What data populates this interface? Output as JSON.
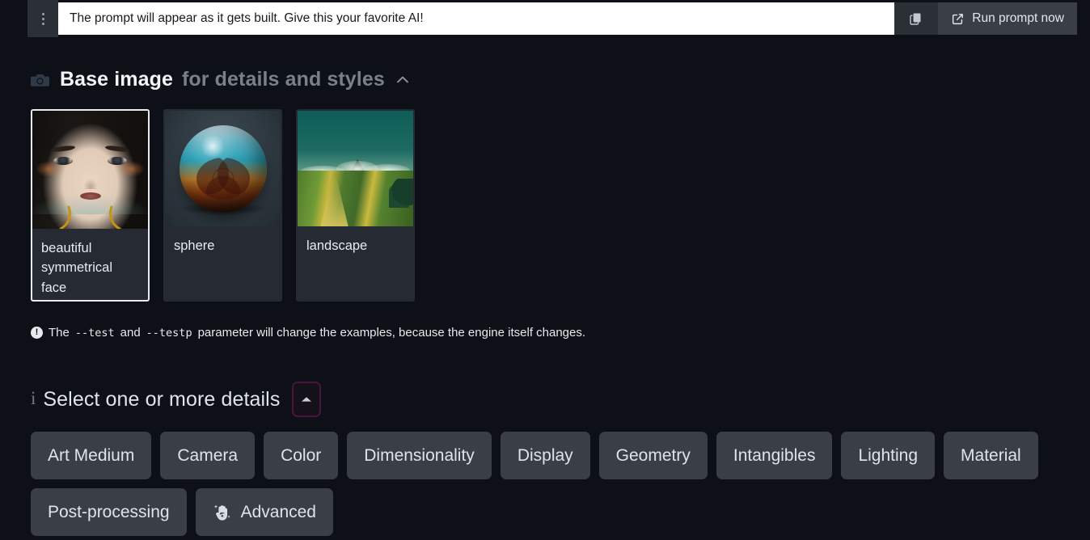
{
  "topbar": {
    "menu_icon": "kebab-menu-icon",
    "prompt_value": "The prompt will appear as it gets built. Give this your favorite AI!",
    "prompt_placeholder": "The prompt will appear as it gets built. Give this your favorite AI!",
    "copy_icon": "copy-icon",
    "run_icon": "external-link-icon",
    "run_label": "Run prompt now"
  },
  "base_image": {
    "icon": "camera-icon",
    "title": "Base image",
    "subtitle": "for details and styles",
    "collapse_icon": "chevron-up-icon",
    "cards": [
      {
        "label": "beautiful symmetrical face",
        "art": "face",
        "selected": true
      },
      {
        "label": "sphere",
        "art": "sphere",
        "selected": false
      },
      {
        "label": "landscape",
        "art": "landscape",
        "selected": false
      }
    ],
    "note": {
      "icon": "info-filled-icon",
      "part1": "The ",
      "code1": "--test",
      "part2": " and ",
      "code2": "--testp",
      "part3": " parameter will change the examples, because the engine itself changes."
    }
  },
  "details": {
    "info_icon": "info-icon",
    "info_glyph": "i",
    "title": "Select one or more details",
    "collapse_icon": "chevron-up-icon",
    "focus_ring_color": "#4a1340",
    "chips": [
      {
        "label": "Art Medium",
        "icon": null
      },
      {
        "label": "Camera",
        "icon": null
      },
      {
        "label": "Color",
        "icon": null
      },
      {
        "label": "Dimensionality",
        "icon": null
      },
      {
        "label": "Display",
        "icon": null
      },
      {
        "label": "Geometry",
        "icon": null
      },
      {
        "label": "Intangibles",
        "icon": null
      },
      {
        "label": "Lighting",
        "icon": null
      },
      {
        "label": "Material",
        "icon": null
      },
      {
        "label": "Post-processing",
        "icon": null
      },
      {
        "label": "Advanced",
        "icon": "magic-hand-icon"
      }
    ]
  },
  "colors": {
    "background": "#0d1117",
    "card_bg": "#262b33",
    "chip_bg": "#3a3f46",
    "topbar_btn_bg": "#2b2f36",
    "selected_border": "#e8ecef",
    "focus_purple": "#4a1340"
  }
}
